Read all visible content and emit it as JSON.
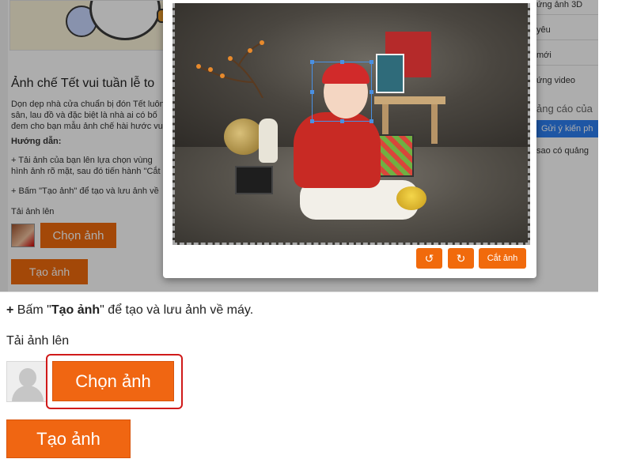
{
  "screenshot": {
    "article_title": "Ảnh chế Tết vui tuần lễ to",
    "paragraph_lines": [
      "Dọn dẹp nhà cửa chuẩn bị đón Tết luôn",
      "sân, lau đồ và đặc biệt là nhà ai có bố",
      "đem cho bạn mẫu ảnh chế hài hước vui"
    ],
    "guide_heading": "Hướng dẫn:",
    "step1_lines": [
      "+ Tải ảnh của bạn lên lựa chọn vùng",
      "hình ảnh rõ mặt, sau đó tiến hành \"Cắt"
    ],
    "step2": "+ Bấm \"Tạo ảnh\" để tạo và lưu ảnh về",
    "upload_label": "Tải ảnh lên",
    "choose_button": "Chọn ảnh",
    "create_button": "Tạo ảnh",
    "right_links": [
      "ứng ảnh 3D",
      "yêu",
      "mới",
      "ứng video",
      "ảng cáo của",
      "sao có quảng"
    ],
    "feedback_button": "Gửi ý kiến ph",
    "modal": {
      "rotate_left_icon": "↺",
      "rotate_right_icon": "↻",
      "crop_button": "Cắt ảnh"
    }
  },
  "page": {
    "instruction_prefix": "+",
    "instruction_pre": "Bấm \"",
    "instruction_bold": "Tạo ảnh",
    "instruction_post": "\" để tạo và lưu ảnh về máy.",
    "upload_label": "Tải ảnh lên",
    "choose_button": "Chọn ảnh",
    "create_button": "Tạo ảnh"
  },
  "colors": {
    "accent_orange": "#f06612",
    "highlight_red": "#d01a1a",
    "feedback_blue": "#2d7ff2"
  }
}
